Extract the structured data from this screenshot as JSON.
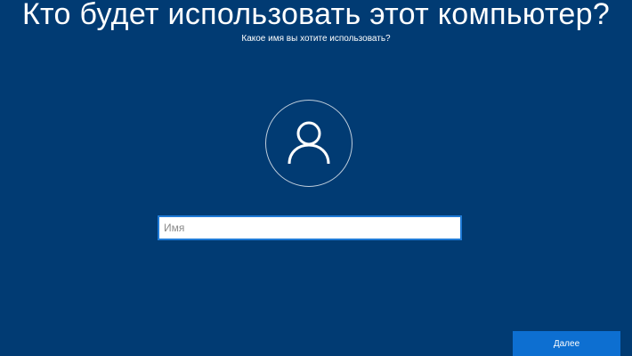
{
  "header": {
    "title": "Кто будет использовать этот компьютер?",
    "subtitle": "Какое имя вы хотите использовать?"
  },
  "avatar": {
    "icon": "user-icon"
  },
  "name_field": {
    "value": "",
    "placeholder": "Имя"
  },
  "footer": {
    "next_label": "Далее"
  },
  "colors": {
    "background": "#013b73",
    "accent": "#0d6fd1",
    "input_border": "#1f7ad6",
    "text": "#ffffff"
  }
}
